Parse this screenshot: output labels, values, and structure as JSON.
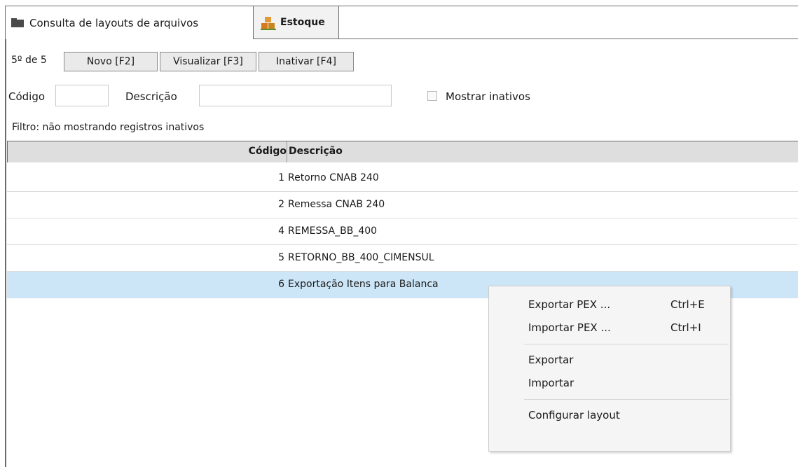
{
  "tabs": [
    {
      "label": "Consulta de layouts de arquivos",
      "icon": "folder-icon",
      "active": true
    },
    {
      "label": "Estoque",
      "icon": "boxes-icon",
      "active": false
    }
  ],
  "toolbar": {
    "counter": "5º de 5",
    "new_label": "Novo [F2]",
    "view_label": "Visualizar [F3]",
    "inactivate_label": "Inativar [F4]"
  },
  "filters": {
    "code_label": "Código",
    "code_value": "",
    "description_label": "Descrição",
    "description_value": "",
    "show_inactive_label": "Mostrar inativos",
    "show_inactive_checked": false,
    "filter_text": "Filtro: não mostrando registros inativos"
  },
  "grid": {
    "columns": [
      "Código",
      "Descrição"
    ],
    "rows": [
      {
        "code": "1",
        "description": "Retorno CNAB 240"
      },
      {
        "code": "2",
        "description": "Remessa CNAB 240"
      },
      {
        "code": "4",
        "description": "REMESSA_BB_400"
      },
      {
        "code": "5",
        "description": "RETORNO_BB_400_CIMENSUL"
      },
      {
        "code": "6",
        "description": "Exportação Itens para Balanca"
      }
    ],
    "selected_row_index": 4
  },
  "context_menu": {
    "items": [
      {
        "label": "Exportar PEX ...",
        "shortcut": "Ctrl+E"
      },
      {
        "label": "Importar PEX ...",
        "shortcut": "Ctrl+I"
      },
      {
        "label": "Exportar",
        "shortcut": ""
      },
      {
        "label": "Importar",
        "shortcut": ""
      },
      {
        "label": "Configurar layout",
        "shortcut": ""
      }
    ]
  },
  "colors": {
    "selection": "#cce6f7",
    "grid_header": "#dedede",
    "menu_background": "#f5f5f5",
    "frame_border": "#6b6b6b"
  }
}
